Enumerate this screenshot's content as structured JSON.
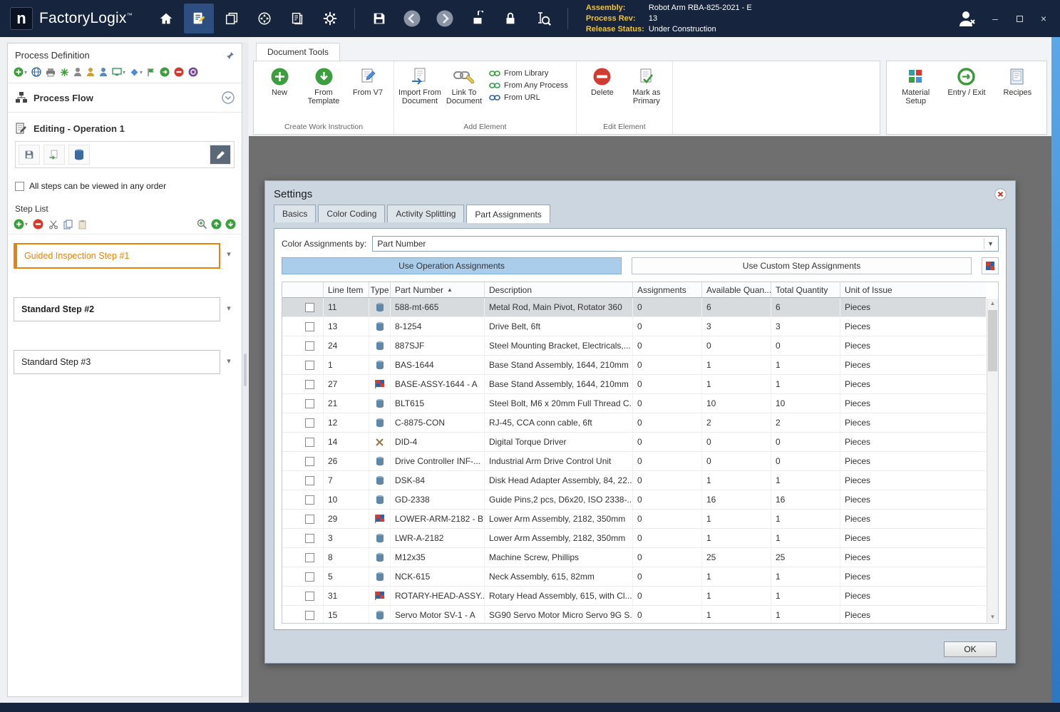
{
  "colors": {
    "titlebar_navy": "#16243e",
    "label_yellow": "#f2c330",
    "guided_orange": "#e8830c",
    "selected_button_blue": "#a9cdeb",
    "dialog_gray_blue": "#ccd6e0",
    "workspace_gray": "#6f6f6f"
  },
  "titlebar": {
    "app_name": "FactoryLogix",
    "trademark": "™",
    "assembly_label": "Assembly:",
    "assembly_value": "Robot Arm RBA-825-2021 - E",
    "process_rev_label": "Process Rev:",
    "process_rev_value": "13",
    "release_status_label": "Release Status:",
    "release_status_value": "Under Construction"
  },
  "sidebar": {
    "title": "Process Definition",
    "process_flow": "Process Flow",
    "editing": "Editing - Operation 1",
    "order_checkbox": "All steps can be viewed in any order",
    "step_list_title": "Step List",
    "steps": [
      {
        "label": "Guided Inspection Step #1",
        "style": "guided"
      },
      {
        "label": "Standard Step #2",
        "style": "bold"
      },
      {
        "label": "Standard Step #3",
        "style": "normal"
      }
    ]
  },
  "ribbon": {
    "tab_label": "Document Tools",
    "create_group": {
      "label": "Create Work Instruction",
      "new": "New",
      "from_template": "From Template",
      "from_v7": "From V7"
    },
    "add_group": {
      "label": "Add Element",
      "import": "Import From Document",
      "link": "Link To Document",
      "from_library": "From Library",
      "from_any_process": "From Any Process",
      "from_url": "From URL"
    },
    "edit_group": {
      "label": "Edit Element",
      "delete": "Delete",
      "mark_primary": "Mark as Primary"
    },
    "right_group": {
      "material_setup": "Material Setup",
      "entry_exit": "Entry / Exit",
      "recipes": "Recipes"
    }
  },
  "settings": {
    "title": "Settings",
    "tabs": [
      "Basics",
      "Color Coding",
      "Activity Splitting",
      "Part Assignments"
    ],
    "color_assignments_label": "Color Assignments by:",
    "color_assignments_value": "Part Number",
    "use_operation_assignments": "Use Operation Assignments",
    "use_custom_step_assignments": "Use Custom Step Assignments",
    "ok_label": "OK",
    "table": {
      "columns": [
        "Line Item",
        "Type",
        "Part Number",
        "Description",
        "Assignments",
        "Available Quan...",
        "Total Quantity",
        "Unit of Issue"
      ],
      "rows": [
        {
          "line": "11",
          "type": "part",
          "part": "588-mt-665",
          "desc": "Metal Rod, Main Pivot, Rotator 360",
          "assignments": "0",
          "available": "6",
          "total": "6",
          "unit": "Pieces",
          "selected": true
        },
        {
          "line": "13",
          "type": "part",
          "part": "8-1254",
          "desc": "Drive Belt, 6ft",
          "assignments": "0",
          "available": "3",
          "total": "3",
          "unit": "Pieces"
        },
        {
          "line": "24",
          "type": "part",
          "part": "887SJF",
          "desc": "Steel Mounting Bracket, Electricals,...",
          "assignments": "0",
          "available": "0",
          "total": "0",
          "unit": "Pieces"
        },
        {
          "line": "1",
          "type": "part",
          "part": "BAS-1644",
          "desc": "Base Stand Assembly, 1644, 210mm",
          "assignments": "0",
          "available": "1",
          "total": "1",
          "unit": "Pieces"
        },
        {
          "line": "27",
          "type": "assembly",
          "part": "BASE-ASSY-1644 - A",
          "desc": "Base Stand Assembly, 1644, 210mm",
          "assignments": "0",
          "available": "1",
          "total": "1",
          "unit": "Pieces"
        },
        {
          "line": "21",
          "type": "part",
          "part": "BLT615",
          "desc": "Steel Bolt, M6 x 20mm Full Thread C...",
          "assignments": "0",
          "available": "10",
          "total": "10",
          "unit": "Pieces"
        },
        {
          "line": "12",
          "type": "part",
          "part": "C-8875-CON",
          "desc": "RJ-45, CCA conn cable, 6ft",
          "assignments": "0",
          "available": "2",
          "total": "2",
          "unit": "Pieces"
        },
        {
          "line": "14",
          "type": "tool",
          "part": "DID-4",
          "desc": "Digital Torque Driver",
          "assignments": "0",
          "available": "0",
          "total": "0",
          "unit": "Pieces"
        },
        {
          "line": "26",
          "type": "part",
          "part": "Drive Controller INF-...",
          "desc": "Industrial Arm Drive Control Unit",
          "assignments": "0",
          "available": "0",
          "total": "0",
          "unit": "Pieces"
        },
        {
          "line": "7",
          "type": "part",
          "part": "DSK-84",
          "desc": "Disk Head Adapter Assembly, 84, 22...",
          "assignments": "0",
          "available": "1",
          "total": "1",
          "unit": "Pieces"
        },
        {
          "line": "10",
          "type": "part",
          "part": "GD-2338",
          "desc": "Guide Pins,2 pcs, D6x20, ISO 2338-...",
          "assignments": "0",
          "available": "16",
          "total": "16",
          "unit": "Pieces"
        },
        {
          "line": "29",
          "type": "assembly",
          "part": "LOWER-ARM-2182 - B",
          "desc": "Lower Arm Assembly, 2182, 350mm",
          "assignments": "0",
          "available": "1",
          "total": "1",
          "unit": "Pieces"
        },
        {
          "line": "3",
          "type": "part",
          "part": "LWR-A-2182",
          "desc": "Lower Arm Assembly, 2182, 350mm",
          "assignments": "0",
          "available": "1",
          "total": "1",
          "unit": "Pieces"
        },
        {
          "line": "8",
          "type": "part",
          "part": "M12x35",
          "desc": "Machine Screw, Phillips",
          "assignments": "0",
          "available": "25",
          "total": "25",
          "unit": "Pieces"
        },
        {
          "line": "5",
          "type": "part",
          "part": "NCK-615",
          "desc": "Neck Assembly, 615, 82mm",
          "assignments": "0",
          "available": "1",
          "total": "1",
          "unit": "Pieces"
        },
        {
          "line": "31",
          "type": "assembly",
          "part": "ROTARY-HEAD-ASSY...",
          "desc": "Rotary Head Assembly, 615, with Cl...",
          "assignments": "0",
          "available": "1",
          "total": "1",
          "unit": "Pieces"
        },
        {
          "line": "15",
          "type": "part",
          "part": "Servo Motor SV-1 - A",
          "desc": "SG90 Servo Motor Micro Servo 9G S...",
          "assignments": "0",
          "available": "1",
          "total": "1",
          "unit": "Pieces"
        }
      ]
    }
  }
}
